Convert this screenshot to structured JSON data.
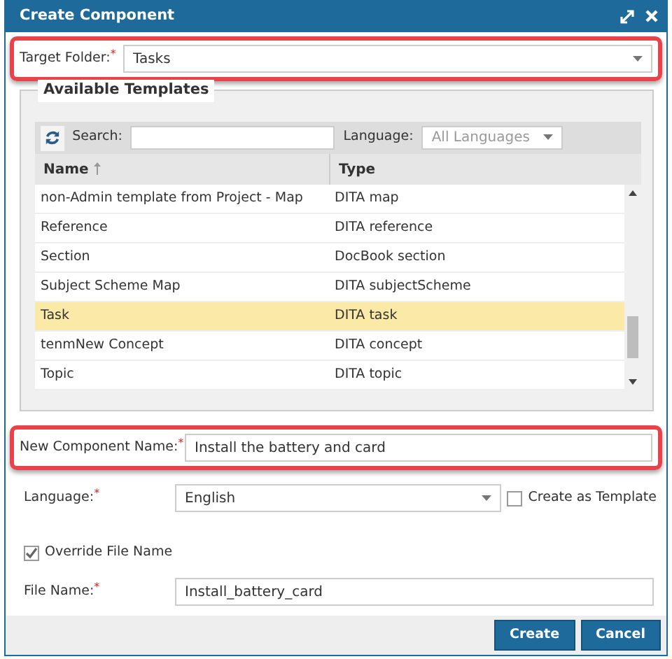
{
  "window": {
    "title": "Create Component"
  },
  "target_folder": {
    "label": "Target Folder:$^{*}$",
    "value": "Tasks"
  },
  "templates": {
    "legend": "Available Templates",
    "search_label": "Search:",
    "language_label": "Language:",
    "language_placeholder": "All Languages",
    "columns": [
      {
        "label": "Name",
        "sorted": true
      },
      {
        "label": "Type",
        "sorted": false
      }
    ],
    "rows": [
      {
        "name": "non-Admin template from Project - Map",
        "type": "DITA map",
        "selected": false
      },
      {
        "name": "Reference",
        "type": "DITA reference",
        "selected": false
      },
      {
        "name": "Section",
        "type": "DocBook section",
        "selected": false
      },
      {
        "name": "Subject Scheme Map",
        "type": "DITA subjectScheme",
        "selected": false
      },
      {
        "name": "Task",
        "type": "DITA task",
        "selected": true
      },
      {
        "name": "tenmNew Concept",
        "type": "DITA concept",
        "selected": false
      },
      {
        "name": "Topic",
        "type": "DITA topic",
        "selected": false
      }
    ]
  },
  "component_name": {
    "label": "New Component Name:$^{*}$",
    "value": "Install the battery and card"
  },
  "language": {
    "label": "Language:$^{*}$",
    "value": "English"
  },
  "create_as_template": {
    "label": "Create as Template",
    "checked": false
  },
  "override_file_name": {
    "label": "Override File Name",
    "checked": true
  },
  "file_name": {
    "label": "File Name:$^{*}$",
    "value": "Install_battery_card"
  },
  "buttons": [
    "Create",
    "Cancel"
  ]
}
